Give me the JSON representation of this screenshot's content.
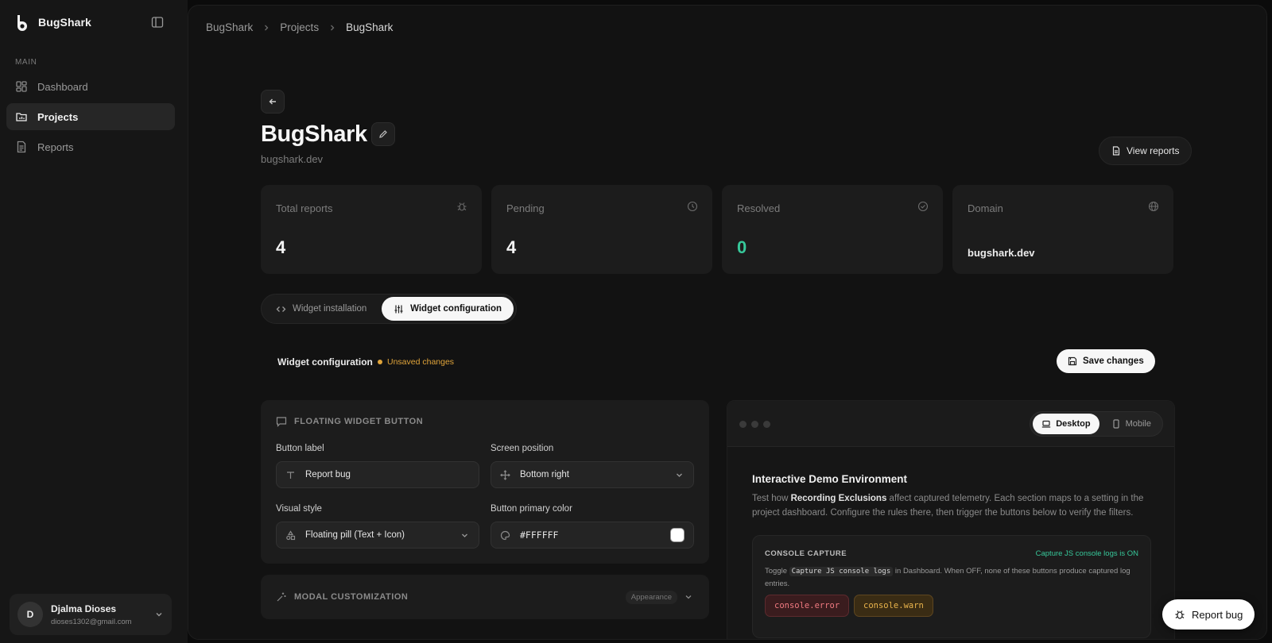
{
  "app": {
    "name": "BugShark"
  },
  "sidebar": {
    "section_label": "MAIN",
    "items": [
      {
        "label": "Dashboard",
        "icon": "dashboard-icon",
        "active": false
      },
      {
        "label": "Projects",
        "icon": "folder-icon",
        "active": true
      },
      {
        "label": "Reports",
        "icon": "file-icon",
        "active": false
      }
    ],
    "user": {
      "initial": "D",
      "name": "Djalma Dioses",
      "email": "dioses1302@gmail.com"
    }
  },
  "breadcrumb": [
    "BugShark",
    "Projects",
    "BugShark"
  ],
  "project": {
    "title": "BugShark",
    "domain": "bugshark.dev",
    "view_reports_label": "View reports"
  },
  "stats": [
    {
      "label": "Total reports",
      "value": "4",
      "icon": "bug-icon"
    },
    {
      "label": "Pending",
      "value": "4",
      "icon": "clock-icon"
    },
    {
      "label": "Resolved",
      "value": "0",
      "icon": "check-circle-icon",
      "color": "#37c89a"
    },
    {
      "label": "Domain",
      "value": "bugshark.dev",
      "icon": "globe-icon"
    }
  ],
  "tabs": [
    {
      "label": "Widget installation",
      "icon": "code-icon",
      "active": false
    },
    {
      "label": "Widget configuration",
      "icon": "sliders-icon",
      "active": true
    }
  ],
  "config": {
    "title": "Widget configuration",
    "unsaved_label": "Unsaved changes",
    "save_label": "Save changes",
    "floating_section": {
      "title": "FLOATING WIDGET BUTTON",
      "button_label": {
        "label": "Button label",
        "value": "Report bug"
      },
      "screen_position": {
        "label": "Screen position",
        "value": "Bottom right"
      },
      "visual_style": {
        "label": "Visual style",
        "value": "Floating pill (Text + Icon)"
      },
      "primary_color": {
        "label": "Button primary color",
        "value": "#FFFFFF"
      }
    },
    "modal_section": {
      "title": "MODAL CUSTOMIZATION",
      "badge": "Appearance"
    }
  },
  "demo": {
    "device_options": [
      {
        "label": "Desktop",
        "active": true
      },
      {
        "label": "Mobile",
        "active": false
      }
    ],
    "title": "Interactive Demo Environment",
    "desc_prefix": "Test how ",
    "desc_bold": "Recording Exclusions",
    "desc_suffix": " affect captured telemetry. Each section maps to a setting in the project dashboard. Configure the rules there, then trigger the buttons below to verify the filters.",
    "console": {
      "title": "CONSOLE CAPTURE",
      "status": "Capture JS console logs is ON",
      "desc_prefix": "Toggle ",
      "desc_code": "Capture JS console logs",
      "desc_suffix": " in Dashboard. When OFF, none of these buttons produce captured log entries.",
      "buttons": [
        "console.error",
        "console.warn"
      ]
    }
  },
  "floating_button": {
    "label": "Report bug"
  },
  "colors": {
    "accent_green": "#37c89a",
    "warning": "#e0a43a",
    "error": "#f07a80"
  }
}
